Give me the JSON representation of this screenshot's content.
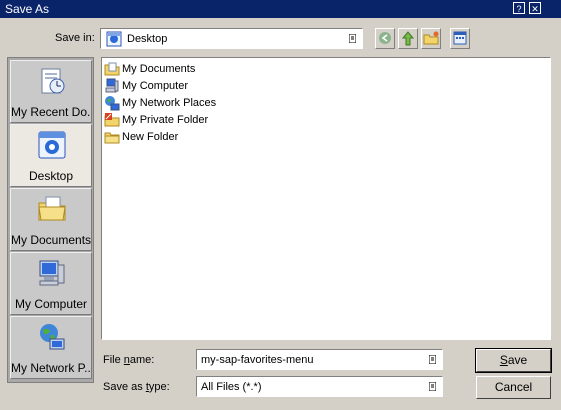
{
  "window": {
    "title": "Save As",
    "help_glyph": "?",
    "close_glyph": "✕"
  },
  "save_in": {
    "label": "Save in:",
    "value": "Desktop"
  },
  "toolbar": [
    "back-icon",
    "up-folder-icon",
    "new-folder-icon",
    "view-menu-icon"
  ],
  "places": [
    {
      "label": "My Recent Do...",
      "icon": "recent-documents-icon"
    },
    {
      "label": "Desktop",
      "icon": "desktop-icon",
      "selected": true
    },
    {
      "label": "My Documents",
      "icon": "my-documents-icon"
    },
    {
      "label": "My Computer",
      "icon": "my-computer-icon"
    },
    {
      "label": "My Network P...",
      "icon": "network-places-icon"
    }
  ],
  "files": [
    {
      "name": "My Documents",
      "icon": "my-documents-icon"
    },
    {
      "name": "My Computer",
      "icon": "my-computer-icon"
    },
    {
      "name": "My Network Places",
      "icon": "network-places-icon"
    },
    {
      "name": "My Private Folder",
      "icon": "private-folder-icon"
    },
    {
      "name": "New Folder",
      "icon": "folder-icon"
    }
  ],
  "file_name": {
    "label_pre": "File ",
    "label_u": "n",
    "label_post": "ame:",
    "value": "my-sap-favorites-menu"
  },
  "save_type": {
    "label_pre": "Save as ",
    "label_u": "t",
    "label_post": "ype:",
    "value": "All Files (*.*)"
  },
  "buttons": {
    "save_u": "S",
    "save_rest": "ave",
    "cancel": "Cancel"
  }
}
